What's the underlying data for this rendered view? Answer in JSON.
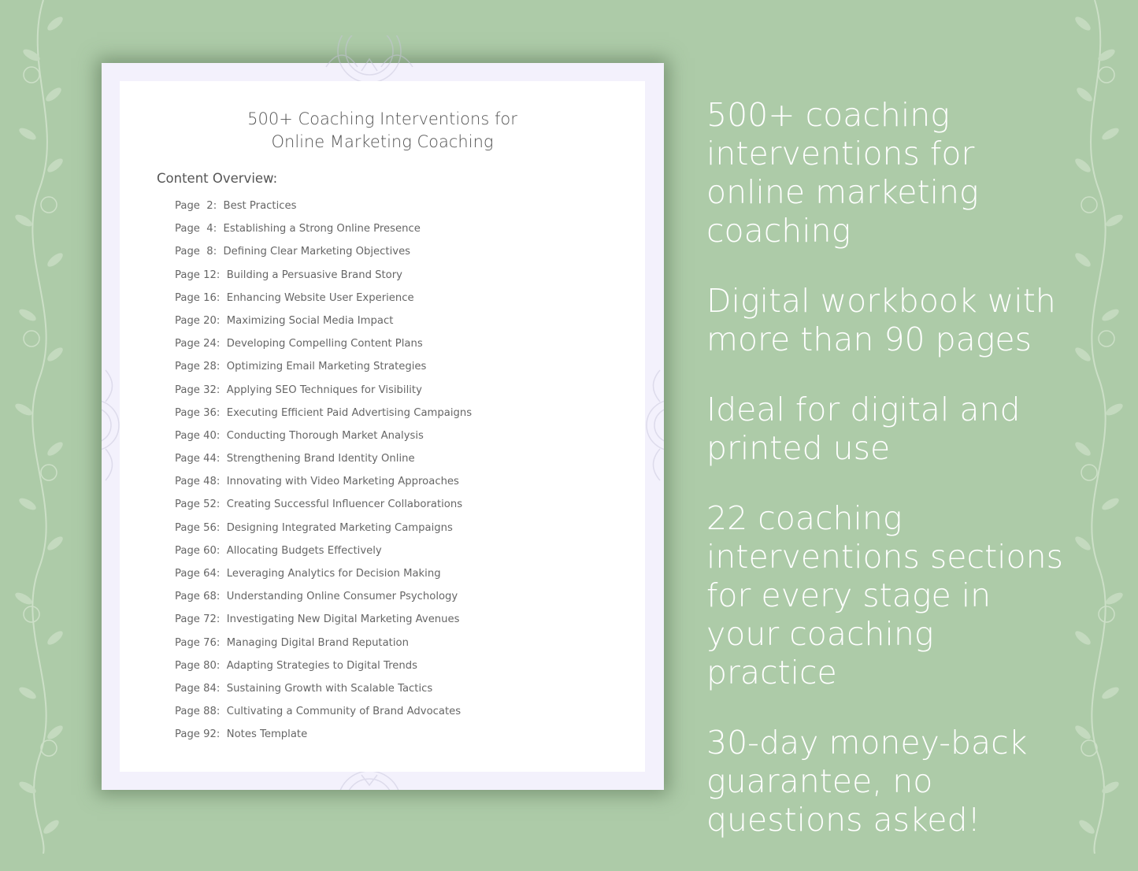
{
  "colors": {
    "background": "#adcba8",
    "page_frame": "#f3f1fc",
    "sheet": "#ffffff",
    "text_gray": "#555555",
    "feature_text": "#ffffff"
  },
  "document": {
    "title_line1": "500+ Coaching Interventions for",
    "title_line2": "Online Marketing Coaching",
    "overview_heading": "Content Overview:",
    "toc": [
      {
        "page": "Page  2:",
        "topic": "Best Practices"
      },
      {
        "page": "Page  4:",
        "topic": "Establishing a Strong Online Presence"
      },
      {
        "page": "Page  8:",
        "topic": "Defining Clear Marketing Objectives"
      },
      {
        "page": "Page 12:",
        "topic": "Building a Persuasive Brand Story"
      },
      {
        "page": "Page 16:",
        "topic": "Enhancing Website User Experience"
      },
      {
        "page": "Page 20:",
        "topic": "Maximizing Social Media Impact"
      },
      {
        "page": "Page 24:",
        "topic": "Developing Compelling Content Plans"
      },
      {
        "page": "Page 28:",
        "topic": "Optimizing Email Marketing Strategies"
      },
      {
        "page": "Page 32:",
        "topic": "Applying SEO Techniques for Visibility"
      },
      {
        "page": "Page 36:",
        "topic": "Executing Efficient Paid Advertising Campaigns"
      },
      {
        "page": "Page 40:",
        "topic": "Conducting Thorough Market Analysis"
      },
      {
        "page": "Page 44:",
        "topic": "Strengthening Brand Identity Online"
      },
      {
        "page": "Page 48:",
        "topic": "Innovating with Video Marketing Approaches"
      },
      {
        "page": "Page 52:",
        "topic": "Creating Successful Influencer Collaborations"
      },
      {
        "page": "Page 56:",
        "topic": "Designing Integrated Marketing Campaigns"
      },
      {
        "page": "Page 60:",
        "topic": "Allocating Budgets Effectively"
      },
      {
        "page": "Page 64:",
        "topic": "Leveraging Analytics for Decision Making"
      },
      {
        "page": "Page 68:",
        "topic": "Understanding Online Consumer Psychology"
      },
      {
        "page": "Page 72:",
        "topic": "Investigating New Digital Marketing Avenues"
      },
      {
        "page": "Page 76:",
        "topic": "Managing Digital Brand Reputation"
      },
      {
        "page": "Page 80:",
        "topic": "Adapting Strategies to Digital Trends"
      },
      {
        "page": "Page 84:",
        "topic": "Sustaining Growth with Scalable Tactics"
      },
      {
        "page": "Page 88:",
        "topic": "Cultivating a Community of Brand Advocates"
      },
      {
        "page": "Page 92:",
        "topic": "Notes Template"
      }
    ]
  },
  "features": [
    "500+ coaching interventions for online marketing coaching",
    "Digital workbook with more than 90 pages",
    "Ideal for digital and printed use",
    "22 coaching interventions sections for every stage in your coaching practice",
    "30-day money-back guarantee, no questions asked!"
  ],
  "decorations": {
    "side_pattern": "floral-vine",
    "page_pattern": "mandala"
  }
}
